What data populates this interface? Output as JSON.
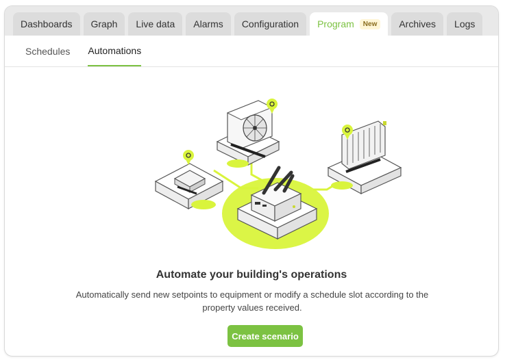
{
  "tabs": [
    {
      "label": "Dashboards"
    },
    {
      "label": "Graph"
    },
    {
      "label": "Live data"
    },
    {
      "label": "Alarms"
    },
    {
      "label": "Configuration"
    },
    {
      "label": "Program",
      "badge": "New",
      "active": true
    },
    {
      "label": "Archives"
    },
    {
      "label": "Logs"
    }
  ],
  "subtabs": [
    {
      "label": "Schedules"
    },
    {
      "label": "Automations",
      "active": true
    }
  ],
  "empty_state": {
    "title": "Automate your building's operations",
    "description": "Automatically send new setpoints to equipment or modify a schedule slot according to the property values received.",
    "cta_label": "Create scenario"
  },
  "colors": {
    "accent": "#7cc242",
    "glow": "#d9f43c",
    "badge_bg": "#fff6d6"
  }
}
